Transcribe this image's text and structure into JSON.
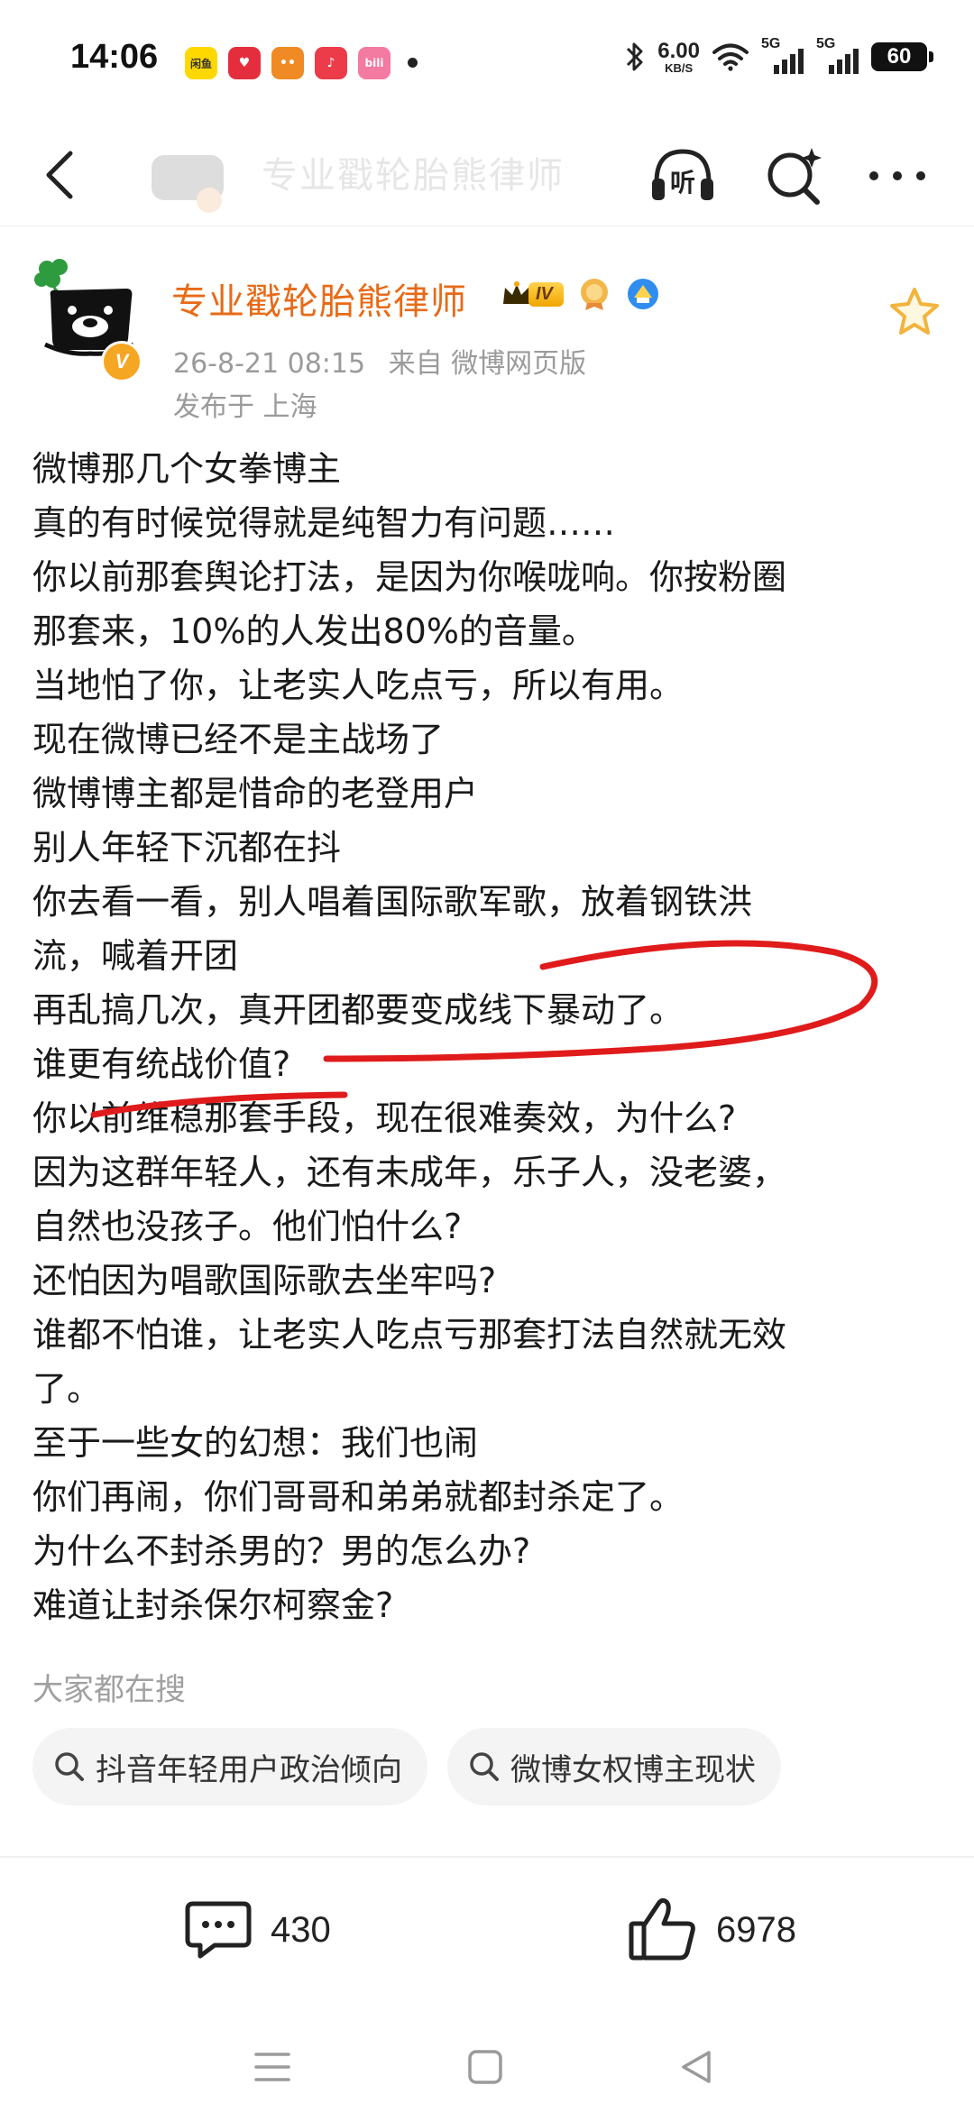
{
  "status_bar": {
    "time": "14:06",
    "net_speed_value": "6.00",
    "net_speed_unit": "KB/S",
    "signal1_label": "5G",
    "signal2_label": "5G",
    "battery": "60",
    "app_icons": [
      {
        "label": "闲鱼",
        "color": "#ffd800"
      },
      {
        "label": "♥",
        "color": "#e52e3d"
      },
      {
        "label": "••",
        "color": "#f08a24"
      },
      {
        "label": "♪",
        "color": "#ec3b49"
      },
      {
        "label": "bili",
        "color": "#f37aa0"
      }
    ]
  },
  "nav": {
    "title": "专业戳轮胎熊律师"
  },
  "post": {
    "author": "专业戳轮胎熊律师",
    "vip_level": "IV",
    "timestamp": "26-8-21 08:15",
    "source": "来自 微博网页版",
    "location": "发布于 上海",
    "lines": [
      "微博那几个女拳博主",
      "真的有时候觉得就是纯智力有问题……",
      "你以前那套舆论打法，是因为你喉咙响。你按粉圈",
      "那套来，10%的人发出80%的音量。",
      "当地怕了你，让老实人吃点亏，所以有用。",
      "现在微博已经不是主战场了",
      "微博博主都是惜命的老登用户",
      "别人年轻下沉都在抖",
      "你去看一看，别人唱着国际歌军歌，放着钢铁洪",
      "流，喊着开团",
      "再乱搞几次，真开团都要变成线下暴动了。",
      "谁更有统战价值?",
      "你以前维稳那套手段，现在很难奏效，为什么?",
      "因为这群年轻人，还有未成年，乐子人，没老婆，",
      "自然也没孩子。他们怕什么?",
      "还怕因为唱歌国际歌去坐牢吗?",
      "谁都不怕谁，让老实人吃点亏那套打法自然就无效",
      "了。",
      "至于一些女的幻想：我们也闹",
      "你们再闹，你们哥哥和弟弟就都封杀定了。",
      "为什么不封杀男的？男的怎么办?",
      "难道让封杀保尔柯察金?"
    ]
  },
  "searches": {
    "heading": "大家都在搜",
    "chips": [
      "抖音年轻用户政治倾向",
      "微博女权博主现状"
    ]
  },
  "actions": {
    "comments": "430",
    "likes": "6978"
  },
  "colors": {
    "author": "#e86a17",
    "annotation": "#e01b1b",
    "meta": "#9a9a9a"
  }
}
